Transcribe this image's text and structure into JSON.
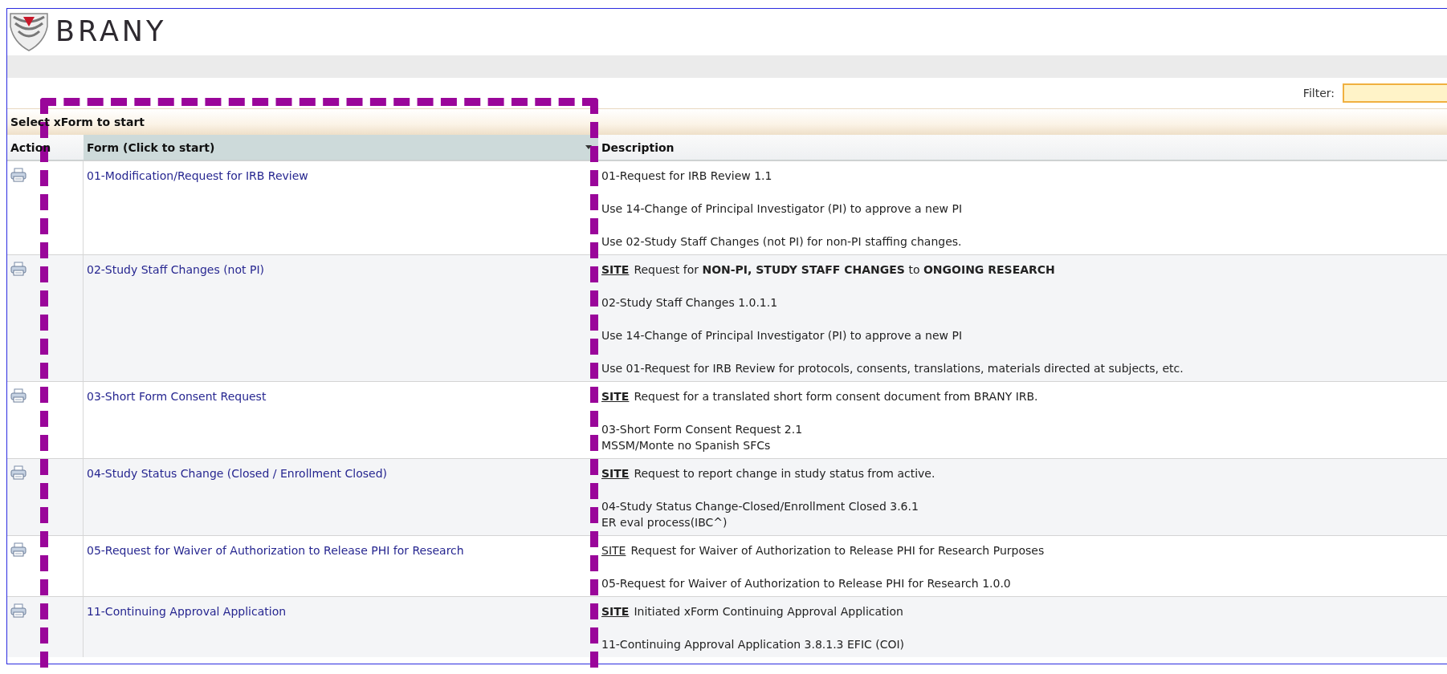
{
  "logo": {
    "text": "BRANY"
  },
  "filter": {
    "label": "Filter:"
  },
  "panel": {
    "title": "Select xForm to start"
  },
  "table": {
    "columns": [
      {
        "label": "Action",
        "sorted": false
      },
      {
        "label": "Form (Click to start)",
        "sorted": true
      },
      {
        "label": "Description",
        "sorted": false
      }
    ],
    "rows": [
      {
        "form": "01-Modification/Request for IRB Review",
        "description": [
          {
            "lines": [
              "01-Request for IRB Review 1.1"
            ]
          },
          {
            "lines": [
              "Use 14-Change of Principal Investigator (PI) to approve a new PI"
            ]
          },
          {
            "lines": [
              "Use 02-Study Staff Changes (not PI) for non-PI staffing changes."
            ]
          }
        ]
      },
      {
        "form": "02-Study Staff Changes (not PI)",
        "description": [
          {
            "tag": "SITE",
            "tag_bold": true,
            "lines": [
              "Request for **NON-PI, STUDY STAFF CHANGES** to **ONGOING RESEARCH**"
            ]
          },
          {
            "lines": [
              "02-Study Staff Changes 1.0.1.1"
            ]
          },
          {
            "lines": [
              "Use 14-Change of Principal Investigator (PI) to approve a new PI"
            ]
          },
          {
            "lines": [
              "Use 01-Request for IRB Review for protocols, consents, translations, materials directed at subjects, etc."
            ]
          }
        ]
      },
      {
        "form": "03-Short Form Consent Request",
        "description": [
          {
            "tag": "SITE",
            "tag_bold": true,
            "lines": [
              "Request for a translated short form consent document from BRANY IRB."
            ]
          },
          {
            "lines": [
              "03-Short Form Consent Request 2.1",
              "MSSM/Monte no Spanish SFCs"
            ]
          }
        ]
      },
      {
        "form": "04-Study Status Change (Closed / Enrollment Closed)",
        "description": [
          {
            "tag": "SITE",
            "tag_bold": true,
            "lines": [
              "Request to report change in study status from active."
            ]
          },
          {
            "lines": [
              "04-Study Status Change-Closed/Enrollment Closed 3.6.1",
              "ER eval process(IBC^)"
            ]
          }
        ]
      },
      {
        "form": "05-Request for Waiver of Authorization to Release PHI for Research",
        "description": [
          {
            "tag": "SITE",
            "tag_bold": false,
            "lines": [
              "Request for Waiver of Authorization to Release PHI for Research Purposes"
            ]
          },
          {
            "lines": [
              "05-Request for Waiver of Authorization to Release PHI for Research 1.0.0"
            ]
          }
        ]
      },
      {
        "form": "11-Continuing Approval Application",
        "description": [
          {
            "tag": "SITE",
            "tag_bold": true,
            "lines": [
              "Initiated xForm Continuing Approval Application"
            ]
          },
          {
            "lines": [
              "11-Continuing Approval Application 3.8.1.3 EFIC (COI)"
            ]
          }
        ]
      }
    ]
  }
}
